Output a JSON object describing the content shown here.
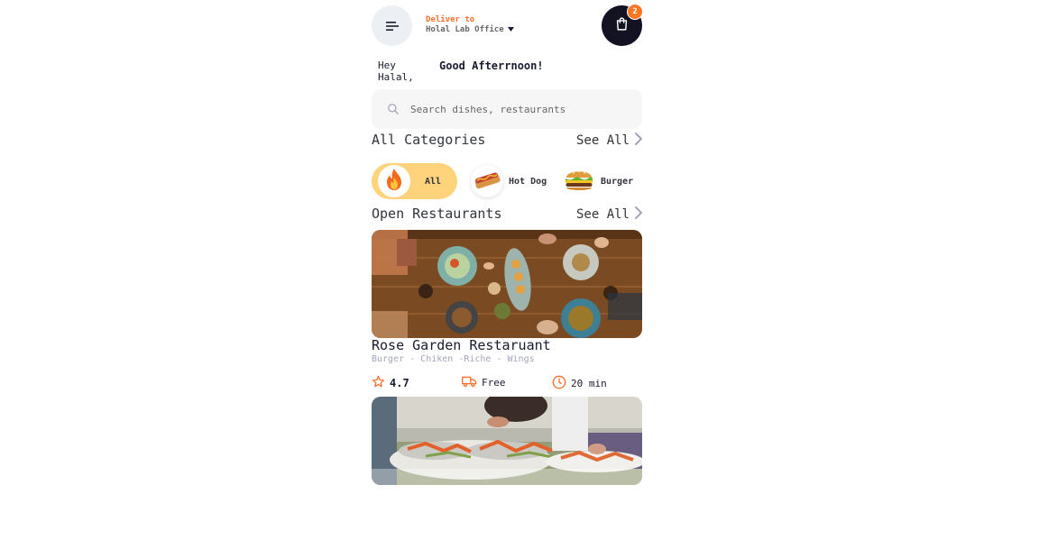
{
  "header": {
    "deliver_label": "Deliver to",
    "location": "Holal Lab Office",
    "cart_count": "2"
  },
  "greeting": {
    "hey": "Hey Halal,",
    "message": "Good Afterrnoon!"
  },
  "search": {
    "placeholder": "Search dishes, restaurants"
  },
  "categories": {
    "title": "All Categories",
    "see_all": "See All",
    "items": [
      {
        "label": "All",
        "icon": "fire-icon",
        "selected": true
      },
      {
        "label": "Hot Dog",
        "icon": "hot-dog-icon"
      },
      {
        "label": "Burger",
        "icon": "burger-icon"
      }
    ]
  },
  "restaurants": {
    "title": "Open Restaurants",
    "see_all": "See All",
    "items": [
      {
        "name": "Rose Garden Restaruant",
        "tags": "Burger - Chiken -Riche - Wings",
        "rating": "4.7",
        "delivery": "Free",
        "time": "20 min"
      }
    ]
  },
  "colors": {
    "accent": "#fc6e2a",
    "badge": "#ff7622",
    "cart_bg": "#121223",
    "chip_selected": "#ffd27c",
    "search_bg": "#f6f6f6",
    "tag_text": "#a0a5ba"
  }
}
